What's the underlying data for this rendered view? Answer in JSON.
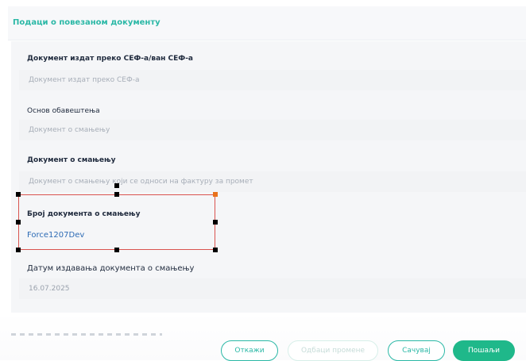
{
  "section": {
    "title": "Подаци о повезаном документу"
  },
  "fields": {
    "issued_via": {
      "label": "Документ издат преко СЕФ-а/ван СЕФ-а",
      "placeholder": "Документ издат преко СЕФ-а"
    },
    "notice_basis": {
      "label": "Основ обавештења",
      "placeholder": "Документ о смањењу"
    },
    "reduction_document": {
      "label": "Документ о смањењу",
      "placeholder": "Документ о смањењу који се односи на фактуру за промет"
    },
    "reduction_document_number": {
      "label": "Број документа о смањењу",
      "value": "Force1207Dev"
    },
    "reduction_document_date": {
      "label": "Датум издавања документа о смањењу",
      "value": "16.07.2025"
    }
  },
  "footer": {
    "cancel_label": "Откажи",
    "discard_label": "Одбаци промене",
    "save_label": "Сачувај",
    "send_label": "Пошаљи"
  },
  "colors": {
    "accent": "#2bb8a6",
    "primary_button": "#1fb88a",
    "selection": "#d9534f",
    "value_text": "#2d6bb5"
  }
}
